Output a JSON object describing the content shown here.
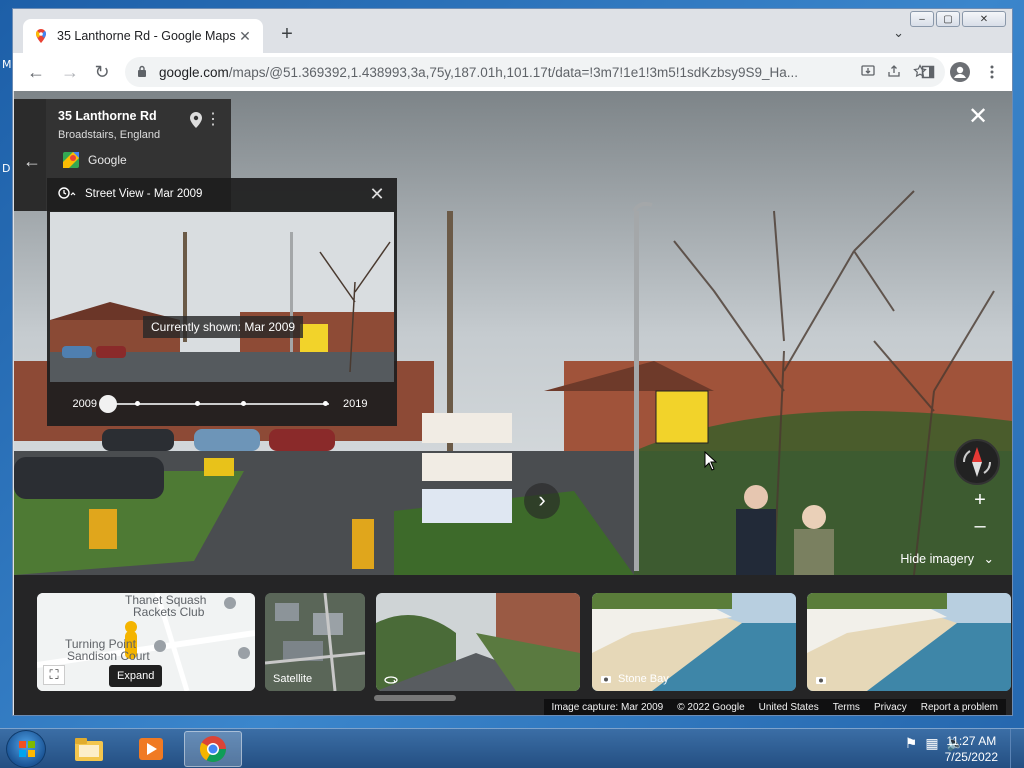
{
  "desktop": {
    "left_letters": [
      "M",
      "D"
    ]
  },
  "browser": {
    "tab": {
      "title": "35 Lanthorne Rd - Google Maps",
      "close": "✕"
    },
    "newtab": "+",
    "tab_menu": "⌄",
    "window_controls": {
      "minimize": "–",
      "maximize": "▢",
      "close": "✕"
    },
    "url_domain": "google.com",
    "url_path": "/maps/@51.369392,1.438993,3a,75y,187.01h,101.17t/data=!3m7!1e1!3m5!1sdKzbsy9S9_Ha...",
    "nav": {
      "back": "←",
      "forward": "→",
      "reload": "↻"
    }
  },
  "place_card": {
    "title": "35 Lanthorne Rd",
    "subtitle": "Broadstairs, England",
    "brand": "Google",
    "back": "←",
    "more": "⋮"
  },
  "time_machine": {
    "title": "Street View - Mar 2009",
    "close": "✕",
    "caption": "Currently shown: Mar 2009",
    "year_start": "2009",
    "year_end": "2019"
  },
  "scene": {
    "exit": "✕",
    "hide_imagery": "Hide imagery",
    "hide_imagery_icon": "⌄",
    "zoom_in": "+",
    "zoom_out": "–",
    "forward": "›"
  },
  "strip": {
    "map_labels": [
      "Thanet Squash",
      "Rackets Club",
      "Turning Point",
      "Sandison Court"
    ],
    "expand": "Expand",
    "satellite": "Satellite",
    "stone_bay": "Stone Bay"
  },
  "footer": [
    "Image capture: Mar 2009",
    "© 2022 Google",
    "United States",
    "Terms",
    "Privacy",
    "Report a problem"
  ],
  "taskbar": {
    "time": "11:27 AM",
    "date": "7/25/2022"
  }
}
